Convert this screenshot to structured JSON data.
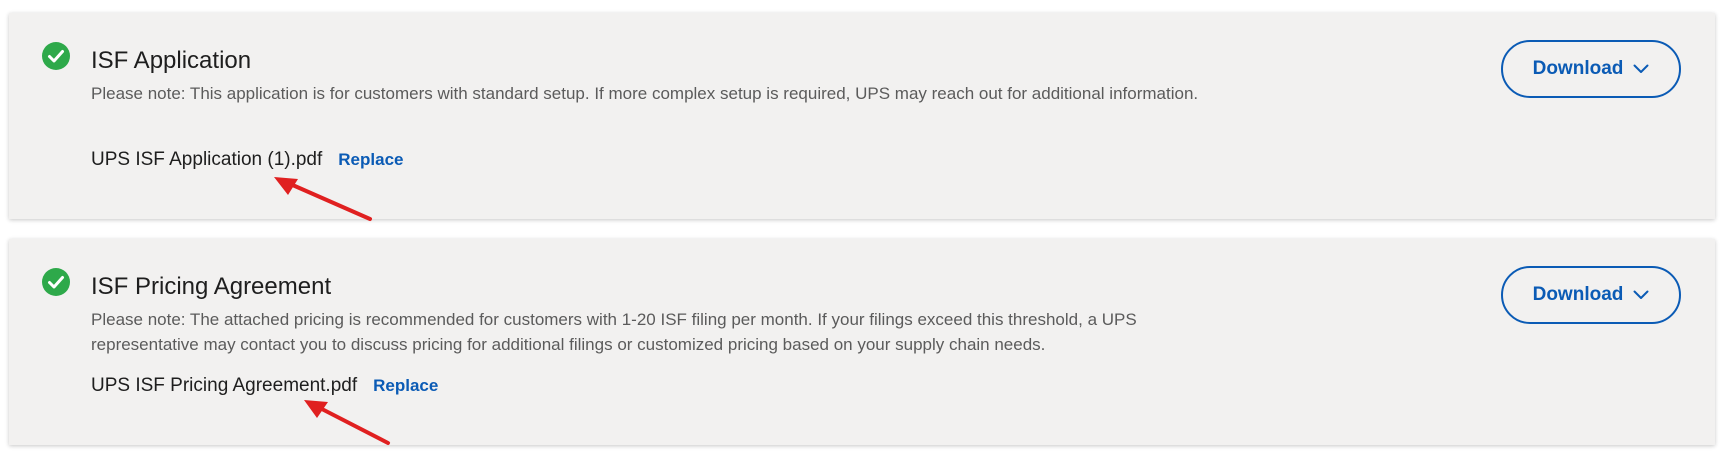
{
  "cards": [
    {
      "title": "ISF Application",
      "note": "Please note: This application is for customers with standard setup. If more complex setup is required, UPS may reach out for additional information.",
      "file_name": "UPS ISF Application (1).pdf",
      "replace_label": "Replace",
      "download_label": "Download"
    },
    {
      "title": "ISF Pricing Agreement",
      "note": "Please note: The attached pricing is recommended for customers with 1-20 ISF filing per month. If your filings exceed this threshold, a UPS representative may contact you to discuss pricing for additional filings or customized pricing based on your supply chain needs.",
      "file_name": "UPS ISF Pricing Agreement.pdf",
      "replace_label": "Replace",
      "download_label": "Download"
    }
  ],
  "icons": {
    "status": "check-circle-icon",
    "dropdown": "chevron-down-icon",
    "annotation": "red-arrow-annotation"
  },
  "colors": {
    "card_background": "#f2f1f0",
    "accent_blue": "#0b5bb5",
    "success_green": "#2ea94a",
    "annotation_red": "#e02020",
    "title_text": "#1e1e1e",
    "note_text": "#5b5b5b"
  }
}
